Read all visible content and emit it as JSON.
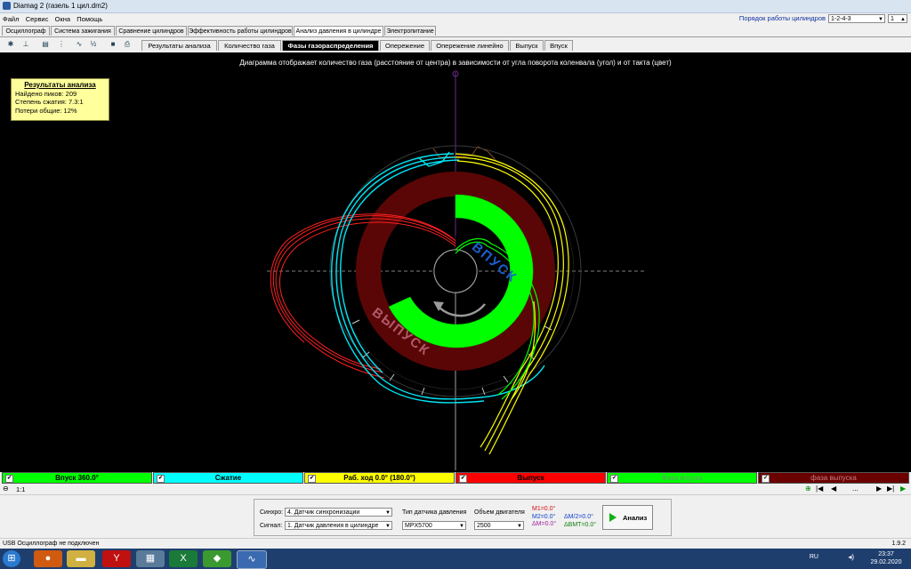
{
  "window": {
    "title": "Diamag 2 (газель 1 цил.dm2)"
  },
  "menu": [
    "Файл",
    "Сервис",
    "Окна",
    "Помощь"
  ],
  "cylinder_order": {
    "label": "Порядок работы цилиндров",
    "value": "1-2-4-3",
    "cylinder": "1"
  },
  "main_tabs": [
    "Осциллограф",
    "Система зажигания",
    "Сравнение цилиндров",
    "Эффективность работы цилиндров",
    "Анализ давления в цилиндре",
    "Электропитание"
  ],
  "sub_tabs": [
    "Результаты анализа",
    "Количество газа",
    "Фазы газораспределения",
    "Опережение",
    "Опережение линейно",
    "Выпуск",
    "Впуск"
  ],
  "plot": {
    "caption": "Диаграмма отображает количество газа (расстояние от центра) в зависимости от угла поворота коленвала (угол) и от такта (цвет)",
    "label_intake": "ВПУСК",
    "label_exhaust": "ВЫПУСК"
  },
  "results": {
    "title": "Результаты анализа",
    "peaks": "Найдено пиков: 209",
    "compression": "Степень сжатия: 7.3:1",
    "losses": "Потери общие: 12%"
  },
  "legend": [
    {
      "label": "Впуск 360.0°",
      "color": "#00ff00",
      "text_color": "#000000"
    },
    {
      "label": "Сжатие",
      "color": "#00ffff",
      "text_color": "#000000"
    },
    {
      "label": "Раб. ход 0.0° (180.0°)",
      "color": "#ffff00",
      "text_color": "#000000"
    },
    {
      "label": "Выпуск",
      "color": "#ff0000",
      "text_color": "#000000"
    },
    {
      "label": "Фаза впуска",
      "color": "#00ff00",
      "text_color": "#6a9a6a"
    },
    {
      "label": "фаза выпуска",
      "color": "#6a0000",
      "text_color": "#c08080"
    }
  ],
  "nav": {
    "scale": "1:1",
    "dots": "..."
  },
  "controls": {
    "sync_label": "Синхро:",
    "sync_value": "4. Датчик синхронизации",
    "signal_label": "Сигнал:",
    "signal_value": "1. Датчик давления в цилиндре",
    "sensor_type_label": "Тип датчика давления",
    "sensor_type_value": "MPX5700",
    "engine_volume_label": "Объем двигателя",
    "engine_volume_value": "2500",
    "m1": "M1=0.0°",
    "m2": "M2=0.0°",
    "dm": "ΔM=0.0°",
    "dm2": "ΔM/2=0.0°",
    "dmt": "ΔВМТ=0.0°",
    "analyze_button": "Анализ"
  },
  "status": {
    "left": "USB Осциллограф не подключен",
    "version": "1.9.2"
  },
  "tray": {
    "lang": "RU",
    "time": "23:37",
    "date": "29.02.2020"
  }
}
